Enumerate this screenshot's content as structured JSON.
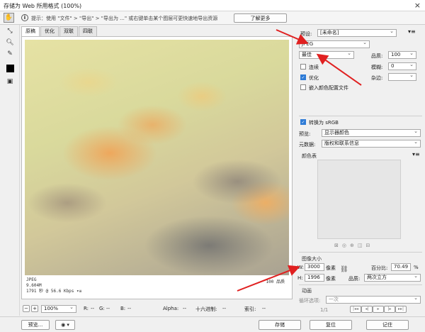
{
  "window": {
    "title": "存储为 Web 所用格式 (100%)",
    "close": "×"
  },
  "info": {
    "text": "提示：使用 \"文件\" > \"导出\" > \"导出为 ...\" 或右键单击某个图层可更快速地导出资源",
    "learn_more": "了解更多"
  },
  "tabs": [
    "原稿",
    "优化",
    "双联",
    "四联"
  ],
  "preview": {
    "format": "JPEG",
    "size": "9.604M",
    "time": "1791 秒 @ 56.6 Kbps",
    "quality_caption": "100 品质"
  },
  "bottom": {
    "zoom": "100%",
    "r_label": "R:",
    "r_value": "--",
    "g_label": "G:",
    "g_value": "--",
    "b_label": "B:",
    "b_value": "--",
    "alpha_label": "Alpha:",
    "alpha_value": "--",
    "hex_label": "十六进制:",
    "hex_value": "--",
    "index_label": "索引:",
    "index_value": "--"
  },
  "footer": {
    "preview": "预览...",
    "save": "存储",
    "reset": "复位",
    "remember": "记住"
  },
  "settings": {
    "preset_label": "预设:",
    "preset_value": "[未命名]",
    "format": "JPEG",
    "quality_preset": "最佳",
    "quality_label": "品质:",
    "quality_value": "100",
    "progressive": "连续",
    "blur_label": "模糊:",
    "blur_value": "0",
    "optimized": "优化",
    "matte_label": "杂边:",
    "embed_profile": "嵌入颜色配置文件",
    "convert_srgb": "转换为 sRGB",
    "preview_label": "预览:",
    "preview_value": "显示器颜色",
    "metadata_label": "元数据:",
    "metadata_value": "版权和联系信息",
    "color_table": "颜色表"
  },
  "image_size": {
    "title": "图像大小",
    "w_label": "W:",
    "w_value": "3000",
    "h_label": "H:",
    "h_value": "1996",
    "unit": "像素",
    "percent_label": "百分比:",
    "percent_value": "70.49",
    "percent_unit": "%",
    "quality_label": "品质:",
    "quality_value": "两次立方"
  },
  "animation": {
    "title": "动画",
    "loop_label": "循环选项:",
    "loop_value": "一次",
    "frame": "1/1"
  }
}
